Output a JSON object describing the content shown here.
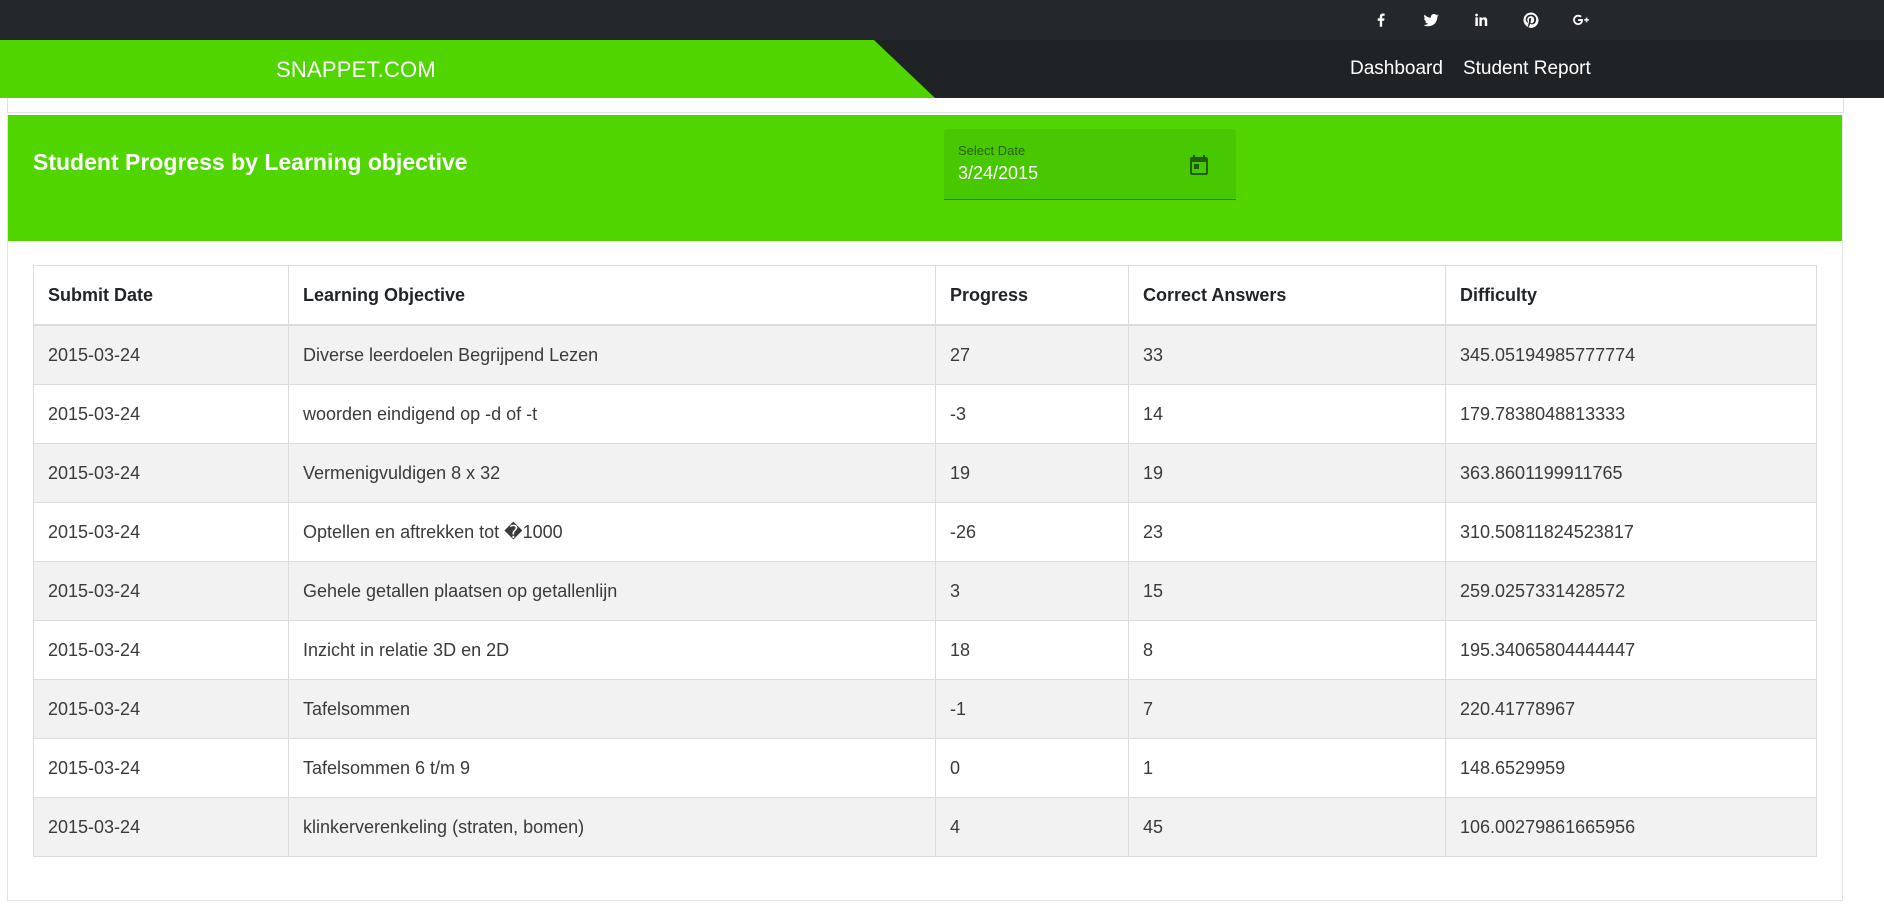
{
  "social": [
    {
      "icon": "facebook-icon"
    },
    {
      "icon": "twitter-icon"
    },
    {
      "icon": "linkedin-icon"
    },
    {
      "icon": "pinterest-icon"
    },
    {
      "icon": "google-plus-icon"
    }
  ],
  "nav": {
    "brand": "SNAPPET.COM",
    "links": [
      "Dashboard",
      "Student Report"
    ]
  },
  "card": {
    "title": "Student Progress by Learning objective",
    "date_label": "Select Date",
    "date_value": "3/24/2015"
  },
  "table": {
    "headers": [
      "Submit Date",
      "Learning Objective",
      "Progress",
      "Correct Answers",
      "Difficulty"
    ],
    "rows": [
      [
        "2015-03-24",
        "Diverse leerdoelen Begrijpend Lezen",
        "27",
        "33",
        "345.05194985777774"
      ],
      [
        "2015-03-24",
        "woorden eindigend op -d of -t",
        "-3",
        "14",
        "179.7838048813333"
      ],
      [
        "2015-03-24",
        "Vermenigvuldigen 8 x 32",
        "19",
        "19",
        "363.8601199911765"
      ],
      [
        "2015-03-24",
        "Optellen en aftrekken tot �1000",
        "-26",
        "23",
        "310.50811824523817"
      ],
      [
        "2015-03-24",
        "Gehele getallen plaatsen op getallenlijn",
        "3",
        "15",
        "259.0257331428572"
      ],
      [
        "2015-03-24",
        "Inzicht in relatie 3D en 2D",
        "18",
        "8",
        "195.34065804444447"
      ],
      [
        "2015-03-24",
        "Tafelsommen",
        "-1",
        "7",
        "220.41778967"
      ],
      [
        "2015-03-24",
        "Tafelsommen 6 t/m 9",
        "0",
        "1",
        "148.6529959"
      ],
      [
        "2015-03-24",
        "klinkerverenkeling (straten, bomen)",
        "4",
        "45",
        "106.00279861665956"
      ]
    ]
  },
  "colors": {
    "accent_green": "#50d500",
    "dark_bar": "#24272b"
  }
}
